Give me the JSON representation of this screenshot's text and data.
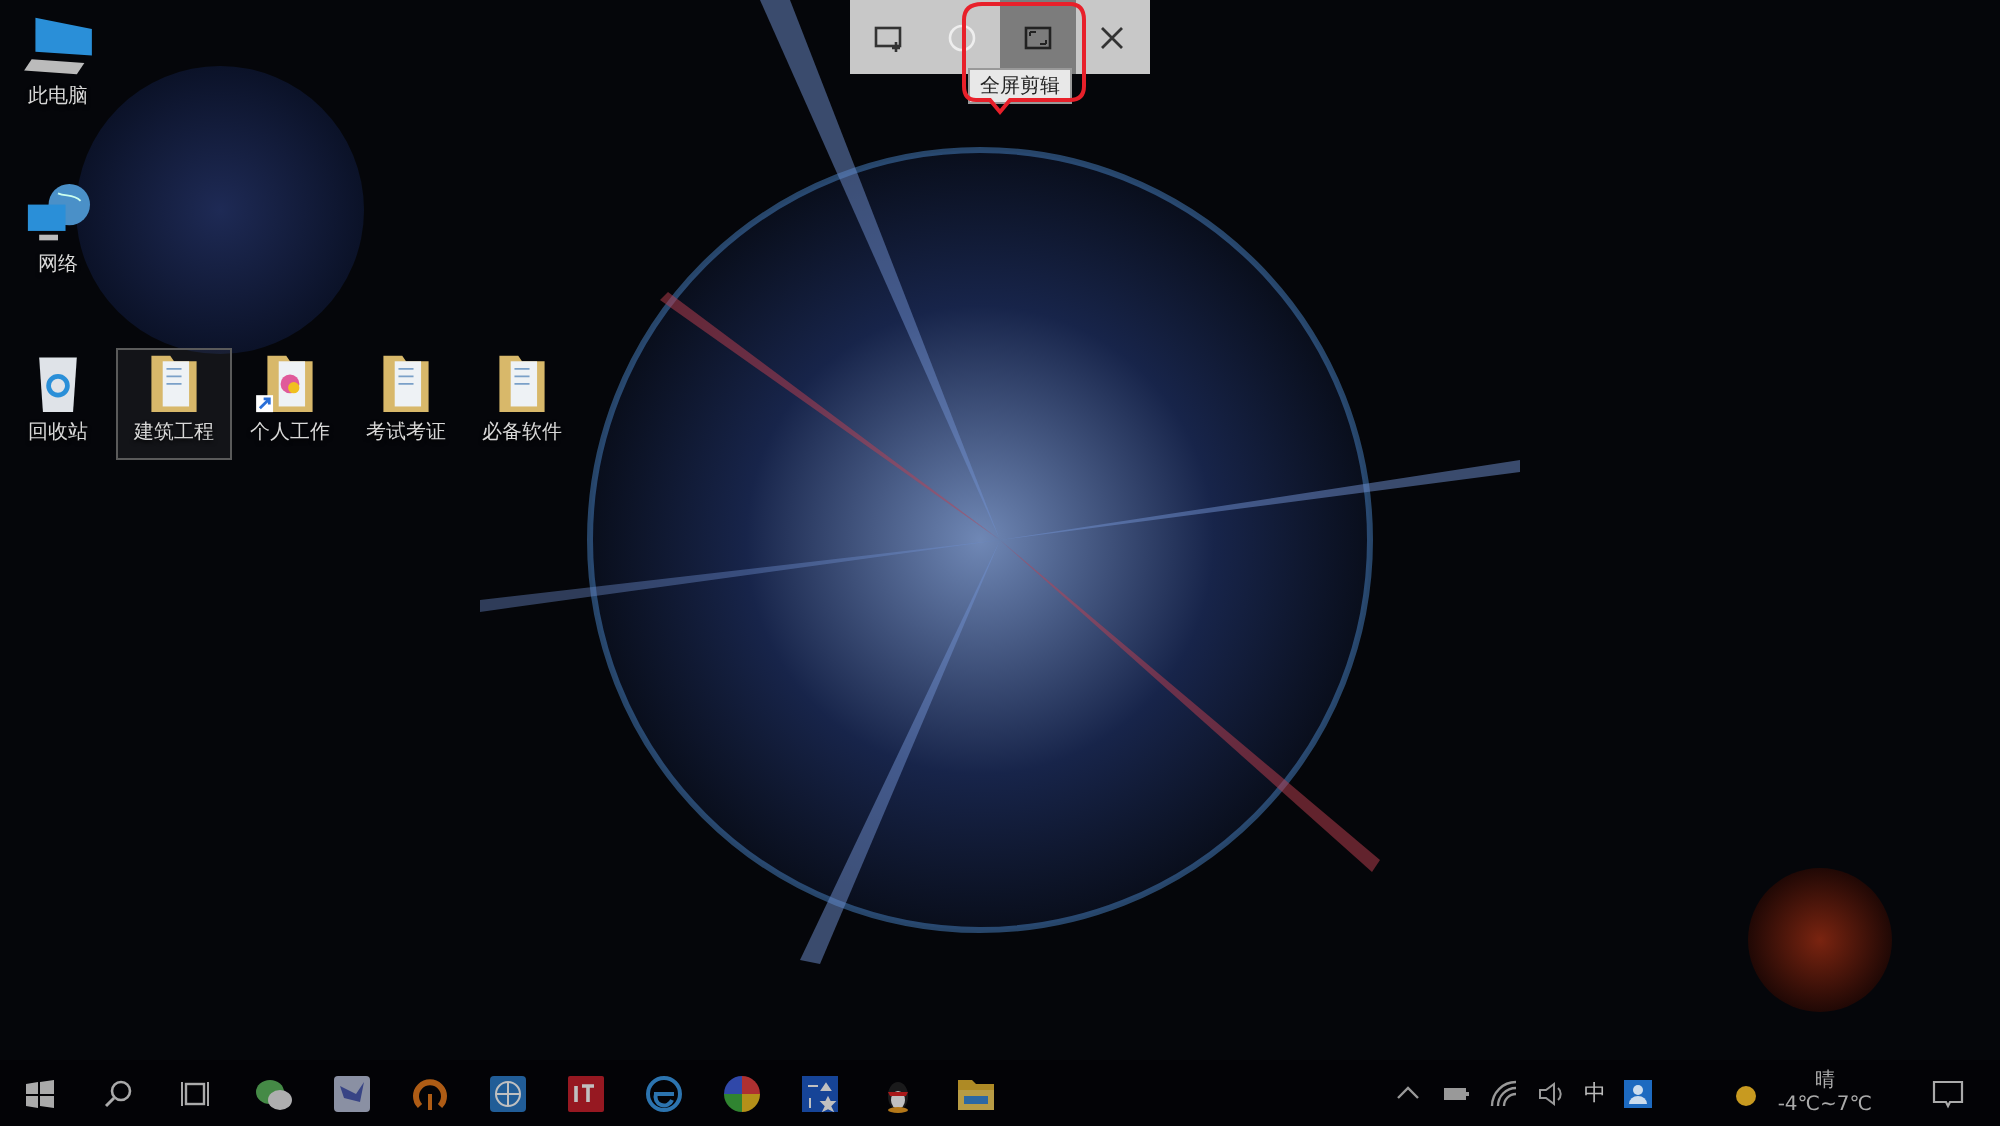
{
  "snip_toolbar": {
    "buttons": [
      {
        "kind": "rectangle",
        "selected": false
      },
      {
        "kind": "freeform",
        "selected": false
      },
      {
        "kind": "fullscreen",
        "selected": true
      },
      {
        "kind": "close",
        "selected": false
      }
    ],
    "tooltip": "全屏剪辑"
  },
  "desktop_icons": [
    {
      "label": "此电脑",
      "kind": "computer",
      "selected": false
    },
    {
      "label": "网络",
      "kind": "network",
      "selected": false
    },
    {
      "label": "回收站",
      "kind": "recycle-bin",
      "selected": false
    },
    {
      "label": "建筑工程",
      "kind": "folder",
      "selected": true
    },
    {
      "label": "个人工作",
      "kind": "folder-shortcut",
      "selected": false
    },
    {
      "label": "考试考证",
      "kind": "folder",
      "selected": false
    },
    {
      "label": "必备软件",
      "kind": "folder",
      "selected": false
    }
  ],
  "taskbar": {
    "apps": [
      {
        "kind": "chat"
      },
      {
        "kind": "bird"
      },
      {
        "kind": "ring"
      },
      {
        "kind": "grid-box"
      },
      {
        "kind": "red-tile"
      },
      {
        "kind": "browser"
      },
      {
        "kind": "color-wheel"
      },
      {
        "kind": "blue-tile"
      },
      {
        "kind": "penguin"
      },
      {
        "kind": "folder"
      }
    ],
    "tray": {
      "ime": "中",
      "weather": {
        "condition": "晴",
        "temperature": "-4℃~7℃"
      }
    }
  }
}
